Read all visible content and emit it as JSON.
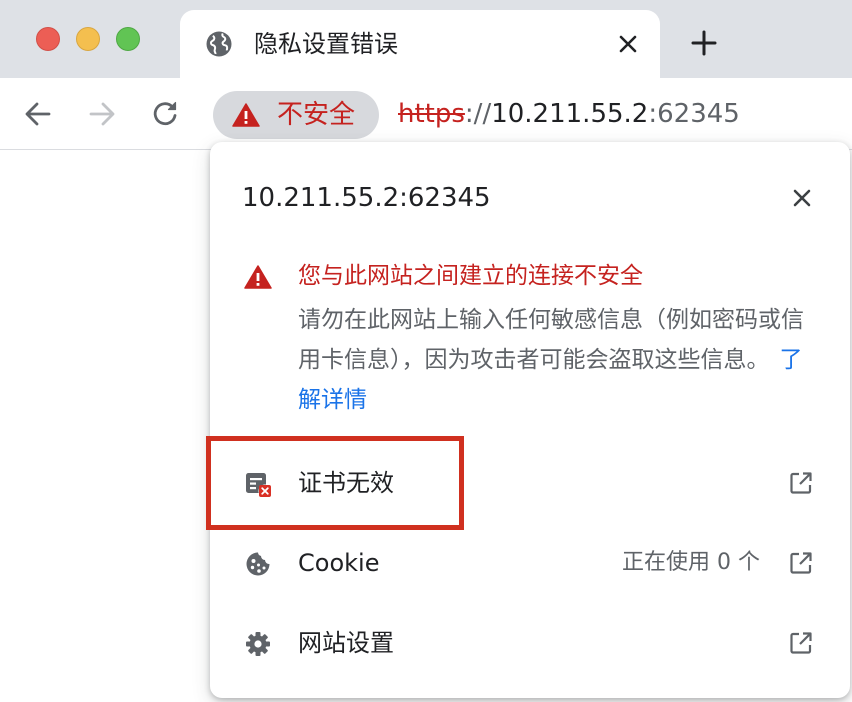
{
  "tab": {
    "title": "隐私设置错误"
  },
  "omnibox": {
    "security_label": "不安全",
    "url_scheme": "https",
    "url_separator": "://",
    "url_host": "10.211.55.2",
    "url_port": ":62345"
  },
  "popup": {
    "host": "10.211.55.2:62345",
    "warning_title": "您与此网站之间建立的连接不安全",
    "warning_body": "请勿在此网站上输入任何敏感信息（例如密码或信用卡信息），因为攻击者可能会盗取这些信息。",
    "learn_more": "了解详情",
    "rows": [
      {
        "label": "证书无效",
        "icon": "certificate-invalid-icon",
        "value": ""
      },
      {
        "label": "Cookie",
        "icon": "cookie-icon",
        "value": "正在使用 0 个"
      },
      {
        "label": "网站设置",
        "icon": "gear-icon",
        "value": ""
      }
    ]
  },
  "colors": {
    "tabstrip": "#dee1e6",
    "danger": "#c5221f",
    "link": "#1a73e8",
    "annotation_box": "#d0301f"
  }
}
